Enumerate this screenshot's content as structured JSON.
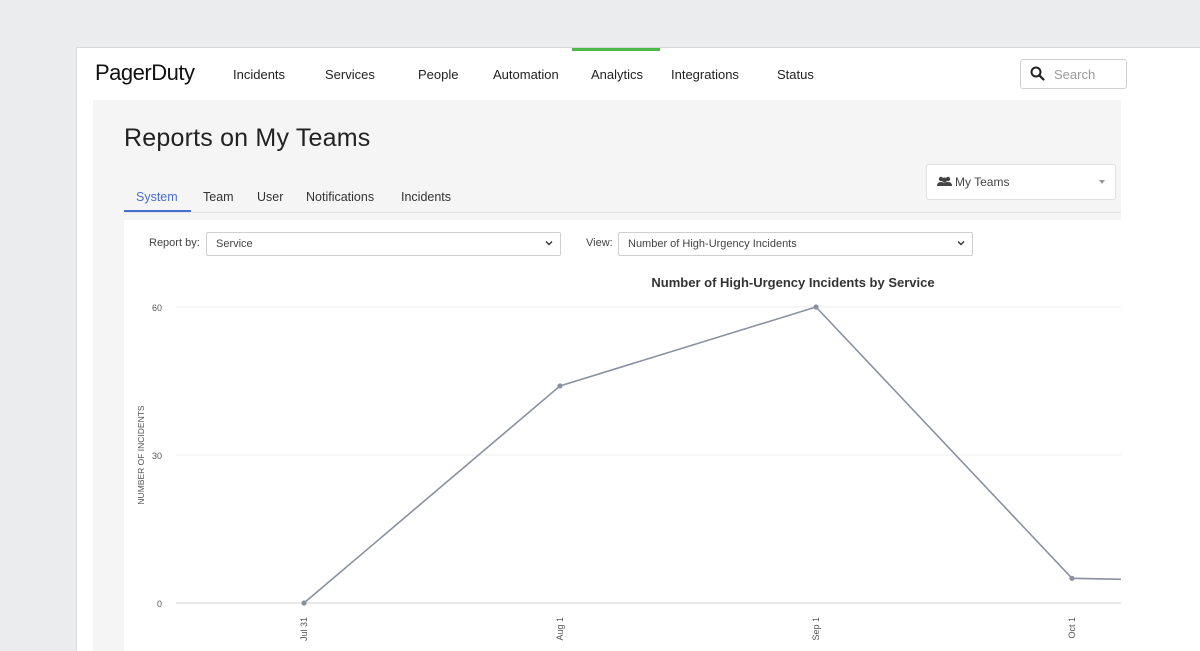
{
  "nav": {
    "logo": "PagerDuty",
    "items": [
      "Incidents",
      "Services",
      "People",
      "Automation",
      "Analytics",
      "Integrations",
      "Status"
    ],
    "active": "Analytics",
    "search_placeholder": "Search"
  },
  "page": {
    "title": "Reports on My Teams",
    "team_selector": "My Teams",
    "tabs": [
      "System",
      "Team",
      "User",
      "Notifications",
      "Incidents"
    ],
    "active_tab": "System"
  },
  "controls": {
    "report_by_label": "Report by:",
    "report_by_value": "Service",
    "view_label": "View:",
    "view_value": "Number of High-Urgency Incidents"
  },
  "colors": {
    "accent": "#4a6fd1",
    "nav_active": "#4fb848",
    "line": "#8a90a0"
  },
  "chart_data": {
    "type": "line",
    "title": "Number of High-Urgency Incidents by Service",
    "ylabel": "NUMBER OF INCIDENTS",
    "xlabel": "",
    "ylim": [
      0,
      60
    ],
    "yticks": [
      0,
      30,
      60
    ],
    "x_tick_labels": [
      "Jul 31",
      "Aug 1",
      "Sep 1",
      "Oct 1"
    ],
    "grid": true,
    "series": [
      {
        "values": [
          0,
          44,
          60,
          5,
          4
        ]
      }
    ]
  }
}
